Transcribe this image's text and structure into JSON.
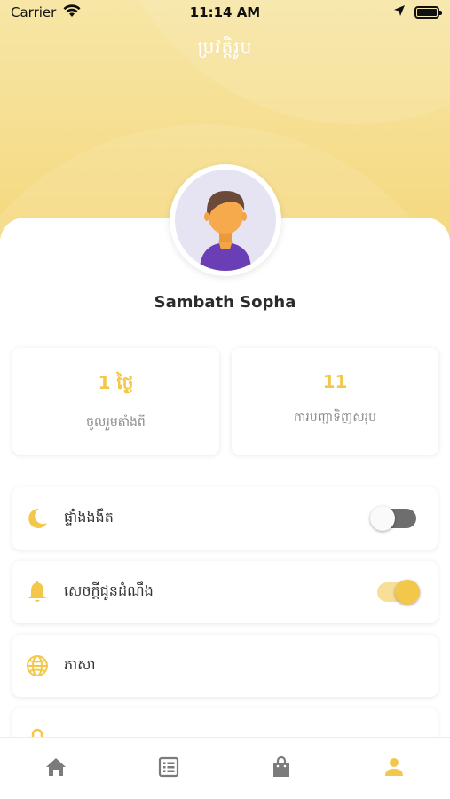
{
  "status_bar": {
    "carrier": "Carrier",
    "time": "11:14 AM"
  },
  "header": {
    "title": "ប្រវត្តិរូប"
  },
  "profile": {
    "name": "Sambath Sopha"
  },
  "stats": [
    {
      "value": "1 ថ្ងៃ",
      "label": "ចូលរួមតាំងពី"
    },
    {
      "value": "11",
      "label": "ការបញ្ជាទិញសរុប"
    }
  ],
  "settings": [
    {
      "label": "ផ្ទាំងងងឹត",
      "icon": "moon-icon",
      "toggle": false
    },
    {
      "label": "សេចក្តីជូនដំណឹង",
      "icon": "bell-icon",
      "toggle": true
    },
    {
      "label": "ភាសា",
      "icon": "globe-icon"
    }
  ],
  "tabs": [
    {
      "icon": "home-icon",
      "active": false
    },
    {
      "icon": "list-icon",
      "active": false
    },
    {
      "icon": "shopping-bag-icon",
      "active": false
    },
    {
      "icon": "person-icon",
      "active": true
    }
  ],
  "colors": {
    "accent": "#f3c84a",
    "header_light": "#f7e6a6",
    "header_dark": "#f4d77a",
    "tab_inactive": "#7b7b7b",
    "text_muted": "#8a8a8a"
  }
}
